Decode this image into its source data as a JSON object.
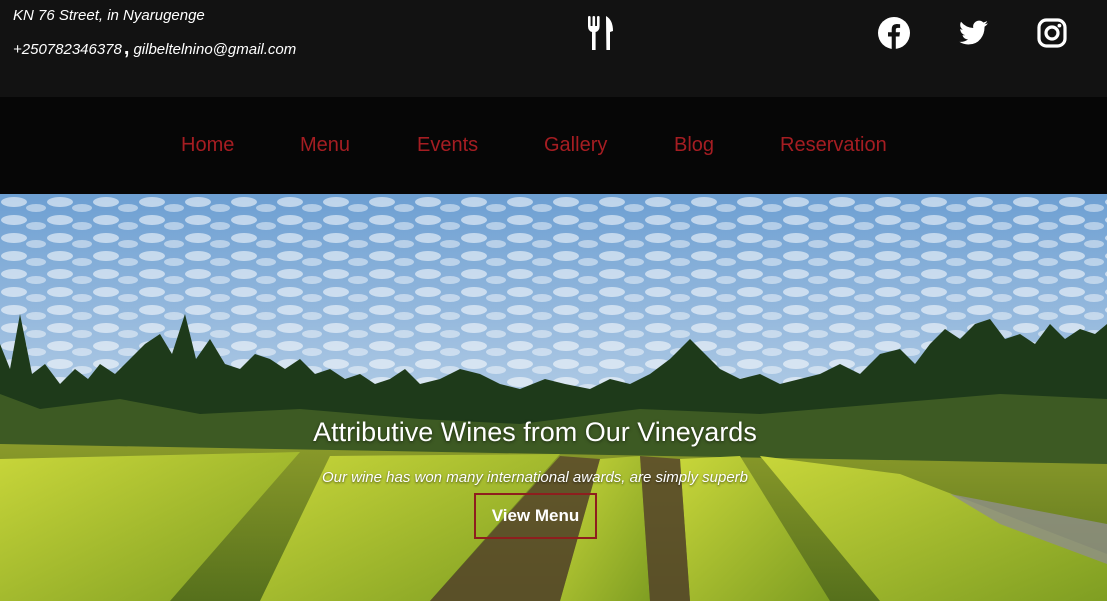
{
  "topbar": {
    "address": "KN 76 Street, in Nyarugenge",
    "phone": "+250782346378",
    "separator": ",",
    "email": "gilbeltelnino@gmail.com",
    "logo_icon": "fork-knife-icon",
    "social": [
      {
        "name": "facebook-icon"
      },
      {
        "name": "twitter-icon"
      },
      {
        "name": "instagram-icon"
      }
    ]
  },
  "nav": {
    "items": [
      {
        "label": "Home"
      },
      {
        "label": "Menu"
      },
      {
        "label": "Events"
      },
      {
        "label": "Gallery"
      },
      {
        "label": "Blog"
      },
      {
        "label": "Reservation"
      }
    ],
    "color": "#a51d22"
  },
  "hero": {
    "title": "Attributive Wines from Our Vineyards",
    "subtitle": "Our wine has won many international awards, are simply superb",
    "button_label": "View Menu",
    "button_border_color": "#8e1e1e"
  }
}
